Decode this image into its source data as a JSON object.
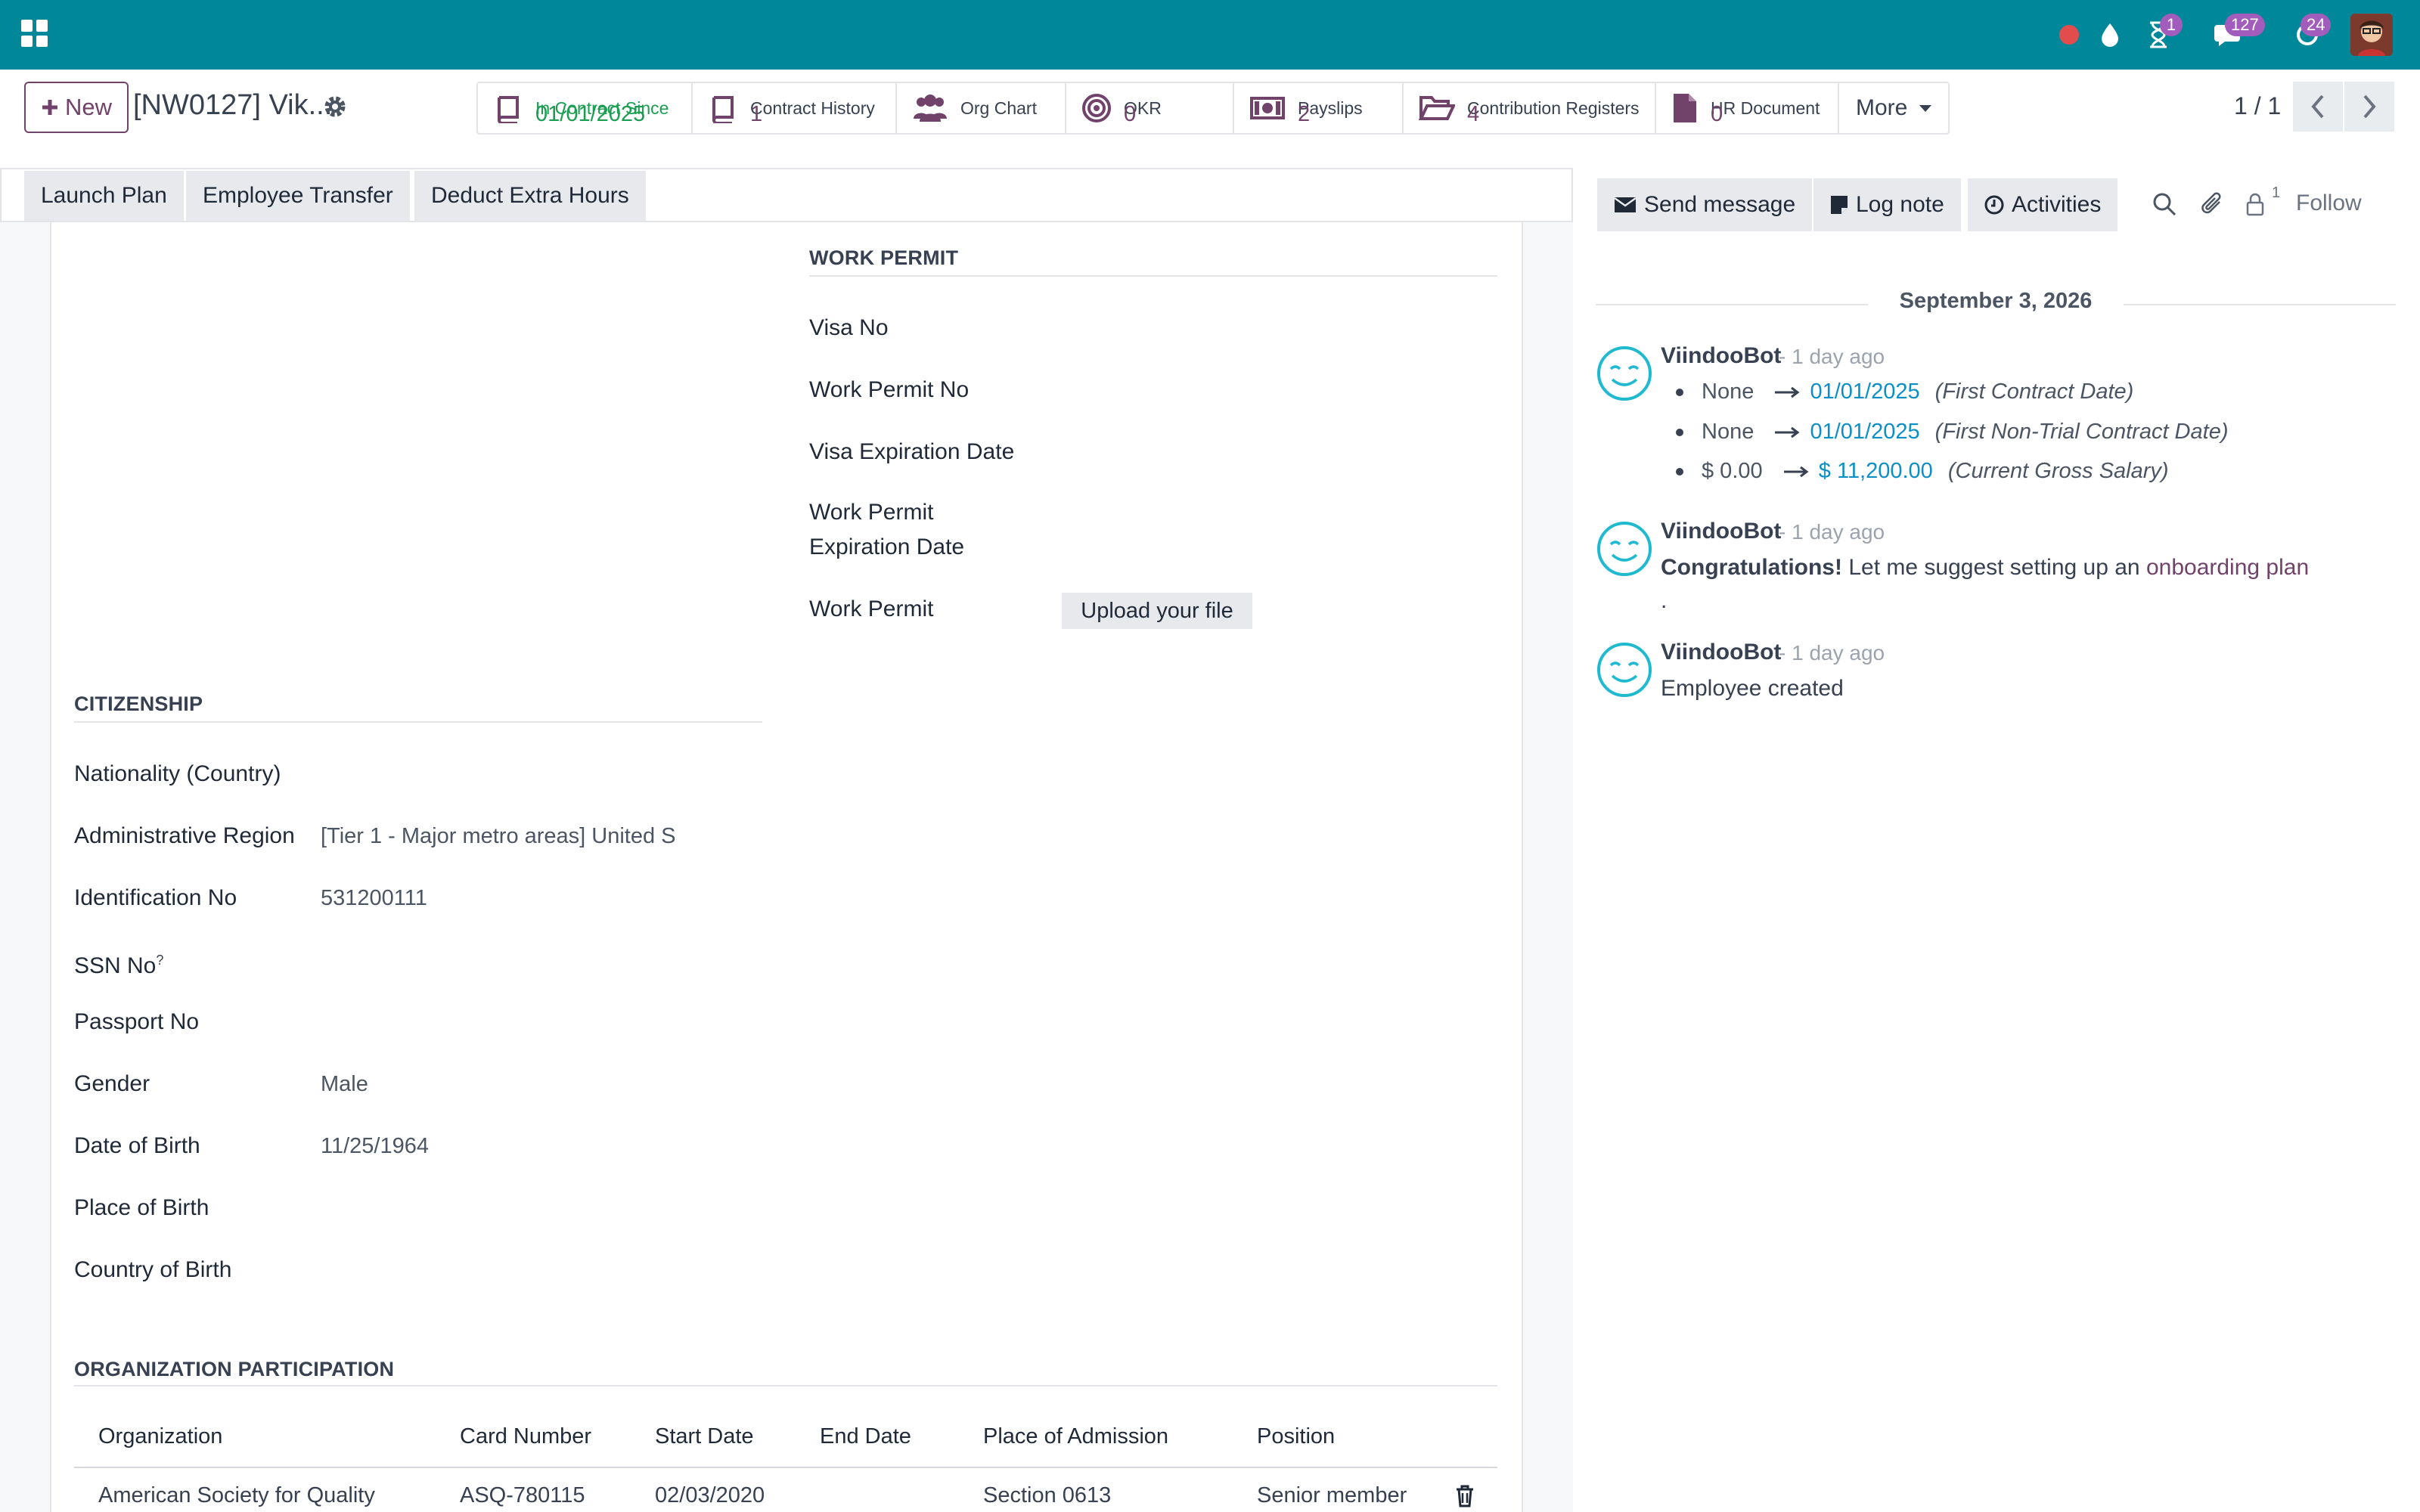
{
  "navbar": {
    "badges": {
      "activities": "1",
      "messages": "127",
      "updates": "24"
    },
    "accent": "#00879a"
  },
  "control_panel": {
    "new_label": "New",
    "record_title": "[NW0127] Vik...",
    "pager": "1 / 1",
    "smart_buttons": [
      {
        "label": "In Contract Since",
        "value": "01/01/2025",
        "icon": "book-icon"
      },
      {
        "label": "Contract History",
        "value": "1",
        "icon": "book-icon"
      },
      {
        "label": "Org Chart",
        "value": "",
        "icon": "users-icon"
      },
      {
        "label": "OKR",
        "value": "0",
        "icon": "target-icon"
      },
      {
        "label": "Payslips",
        "value": "2",
        "icon": "money-icon"
      },
      {
        "label": "Contribution Registers",
        "value": "4",
        "icon": "folder-open-icon"
      },
      {
        "label": "HR Document",
        "value": "0",
        "icon": "file-icon"
      }
    ],
    "more_label": "More"
  },
  "header_buttons": [
    "Launch Plan",
    "Employee Transfer",
    "Deduct Extra Hours"
  ],
  "work_permit": {
    "title": "WORK PERMIT",
    "visa_no": "Visa No",
    "work_permit_no": "Work Permit No",
    "visa_expiration": "Visa Expiration Date",
    "wp_expiration_1": "Work Permit",
    "wp_expiration_2": "Expiration Date",
    "work_permit": "Work Permit",
    "upload_label": "Upload your file"
  },
  "citizenship": {
    "title": "CITIZENSHIP",
    "fields": [
      {
        "label": "Nationality (Country)",
        "value": ""
      },
      {
        "label": "Administrative Region",
        "value": "[Tier 1 - Major metro areas] United S"
      },
      {
        "label": "Identification No",
        "value": "531200111"
      },
      {
        "label": "SSN No",
        "value": ""
      },
      {
        "label": "Passport No",
        "value": ""
      },
      {
        "label": "Gender",
        "value": "Male"
      },
      {
        "label": "Date of Birth",
        "value": "11/25/1964"
      },
      {
        "label": "Place of Birth",
        "value": ""
      },
      {
        "label": "Country of Birth",
        "value": ""
      }
    ],
    "ssn_help": "?"
  },
  "org_participation": {
    "title": "ORGANIZATION PARTICIPATION",
    "columns": [
      "Organization",
      "Card Number",
      "Start Date",
      "End Date",
      "Place of Admission",
      "Position"
    ],
    "rows": [
      [
        "American Society for Quality",
        "ASQ-780115",
        "02/03/2020",
        "",
        "Section 0613",
        "Senior member"
      ]
    ]
  },
  "chatter": {
    "send_message": "Send message",
    "log_note": "Log note",
    "activities": "Activities",
    "followers_count": "1",
    "follow": "Follow",
    "date": "September 3, 2026",
    "messages": [
      {
        "author": "ViindooBot",
        "ago": "- 1 day ago",
        "tracking": [
          {
            "old": "None",
            "new": "01/01/2025",
            "field": "(First Contract Date)"
          },
          {
            "old": "None",
            "new": "01/01/2025",
            "field": "(First Non-Trial Contract Date)"
          },
          {
            "old": "$ 0.00",
            "new": "$ 11,200.00",
            "field": "(Current Gross Salary)"
          }
        ]
      },
      {
        "author": "ViindooBot",
        "ago": "- 1 day ago",
        "bold": "Congratulations!",
        "text": "Let me suggest setting up an",
        "link": "onboarding plan",
        "tail": "."
      },
      {
        "author": "ViindooBot",
        "ago": "- 1 day ago",
        "text": "Employee created"
      }
    ]
  }
}
